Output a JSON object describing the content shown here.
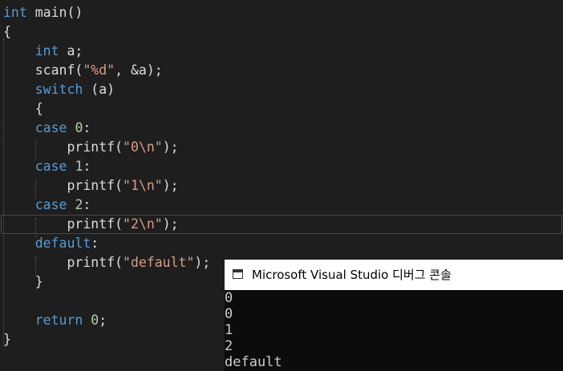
{
  "editor": {
    "lines": [
      [
        {
          "t": "int",
          "c": "kw"
        },
        {
          "t": " main()",
          "c": "plain"
        }
      ],
      [
        {
          "t": "{",
          "c": "plain"
        }
      ],
      [
        {
          "t": "    ",
          "c": "plain"
        },
        {
          "t": "int",
          "c": "kw"
        },
        {
          "t": " a;",
          "c": "plain"
        }
      ],
      [
        {
          "t": "    scanf(",
          "c": "plain"
        },
        {
          "t": "\"%d\"",
          "c": "str"
        },
        {
          "t": ", &a);",
          "c": "plain"
        }
      ],
      [
        {
          "t": "    ",
          "c": "plain"
        },
        {
          "t": "switch",
          "c": "kw"
        },
        {
          "t": " (a)",
          "c": "plain"
        }
      ],
      [
        {
          "t": "    {",
          "c": "plain"
        }
      ],
      [
        {
          "t": "    ",
          "c": "plain"
        },
        {
          "t": "case",
          "c": "kw"
        },
        {
          "t": " ",
          "c": "plain"
        },
        {
          "t": "0",
          "c": "num"
        },
        {
          "t": ":",
          "c": "plain"
        }
      ],
      [
        {
          "t": "        printf(",
          "c": "plain"
        },
        {
          "t": "\"0\\n\"",
          "c": "str"
        },
        {
          "t": ");",
          "c": "plain"
        }
      ],
      [
        {
          "t": "    ",
          "c": "plain"
        },
        {
          "t": "case",
          "c": "kw"
        },
        {
          "t": " ",
          "c": "plain"
        },
        {
          "t": "1",
          "c": "num"
        },
        {
          "t": ":",
          "c": "plain"
        }
      ],
      [
        {
          "t": "        printf(",
          "c": "plain"
        },
        {
          "t": "\"1\\n\"",
          "c": "str"
        },
        {
          "t": ");",
          "c": "plain"
        }
      ],
      [
        {
          "t": "    ",
          "c": "plain"
        },
        {
          "t": "case",
          "c": "kw"
        },
        {
          "t": " ",
          "c": "plain"
        },
        {
          "t": "2",
          "c": "num"
        },
        {
          "t": ":",
          "c": "plain"
        }
      ],
      [
        {
          "t": "        printf(",
          "c": "plain"
        },
        {
          "t": "\"2\\n\"",
          "c": "str"
        },
        {
          "t": ");",
          "c": "plain"
        }
      ],
      [
        {
          "t": "    ",
          "c": "plain"
        },
        {
          "t": "default",
          "c": "kw"
        },
        {
          "t": ":",
          "c": "plain"
        }
      ],
      [
        {
          "t": "        printf(",
          "c": "plain"
        },
        {
          "t": "\"default\"",
          "c": "str"
        },
        {
          "t": ");",
          "c": "plain"
        }
      ],
      [
        {
          "t": "    }",
          "c": "plain"
        }
      ],
      [
        {
          "t": "",
          "c": "plain"
        }
      ],
      [
        {
          "t": "    ",
          "c": "plain"
        },
        {
          "t": "return",
          "c": "kw"
        },
        {
          "t": " ",
          "c": "plain"
        },
        {
          "t": "0",
          "c": "num"
        },
        {
          "t": ";",
          "c": "plain"
        }
      ],
      [
        {
          "t": "}",
          "c": "plain"
        }
      ]
    ]
  },
  "console": {
    "title": "Microsoft Visual Studio 디버그 콘솔",
    "output": [
      "0",
      "0",
      "1",
      "2",
      "default"
    ]
  },
  "colors": {
    "editor_background": "#1e1e1e",
    "keyword": "#569cd6",
    "string": "#d69d85",
    "number": "#b5cea8",
    "text": "#dcdcdc",
    "console_background": "#0c0c0c",
    "console_text": "#cccccc"
  },
  "icons": {
    "console_window": "console-window-icon"
  }
}
